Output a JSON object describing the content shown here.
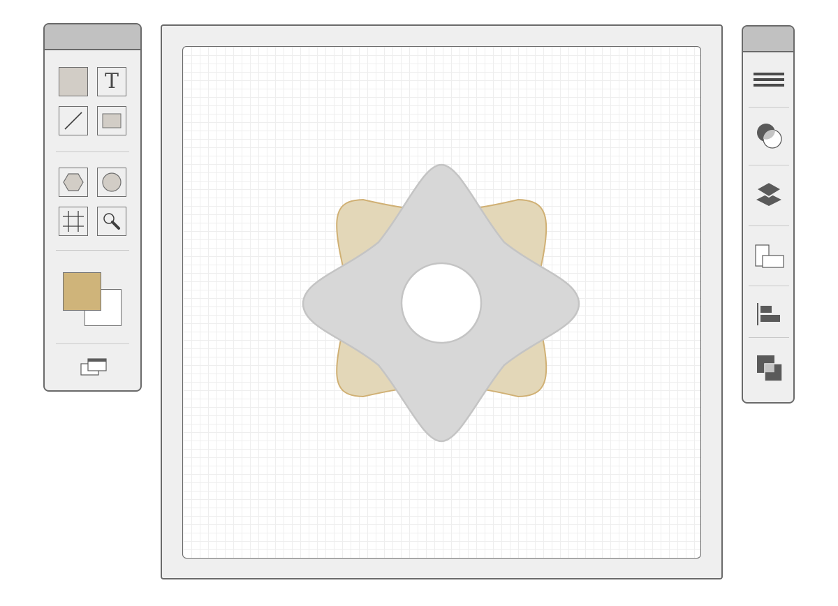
{
  "tools": {
    "text_tool_glyph": "T",
    "items": [
      {
        "name": "fill-tool",
        "icon": "filled-square-icon"
      },
      {
        "name": "text-tool",
        "icon": "text-icon"
      },
      {
        "name": "line-tool",
        "icon": "line-icon"
      },
      {
        "name": "rectangle-tool",
        "icon": "rectangle-icon"
      },
      {
        "name": "polygon-tool",
        "icon": "hexagon-icon"
      },
      {
        "name": "ellipse-tool",
        "icon": "circle-icon"
      },
      {
        "name": "crop-tool",
        "icon": "crop-icon"
      },
      {
        "name": "zoom-tool",
        "icon": "magnifier-icon"
      }
    ],
    "foreground_color": "#cfb47a",
    "background_color": "#ffffff",
    "window_icon": "window-arrange-icon"
  },
  "palette": {
    "items": [
      {
        "name": "menu-button",
        "icon": "hamburger-icon"
      },
      {
        "name": "blend-button",
        "icon": "overlap-circles-icon"
      },
      {
        "name": "layers-button",
        "icon": "layers-icon"
      },
      {
        "name": "arrange-button",
        "icon": "arrange-icon"
      },
      {
        "name": "align-button",
        "icon": "align-left-icon"
      },
      {
        "name": "combine-button",
        "icon": "combine-squares-icon"
      }
    ]
  },
  "canvas": {
    "shape_back_fill": "#e3d7b8",
    "shape_back_stroke": "#d0b074",
    "shape_front_fill": "#d7d7d7",
    "shape_front_stroke": "#c4c4c4",
    "hole_fill": "#ffffff"
  }
}
